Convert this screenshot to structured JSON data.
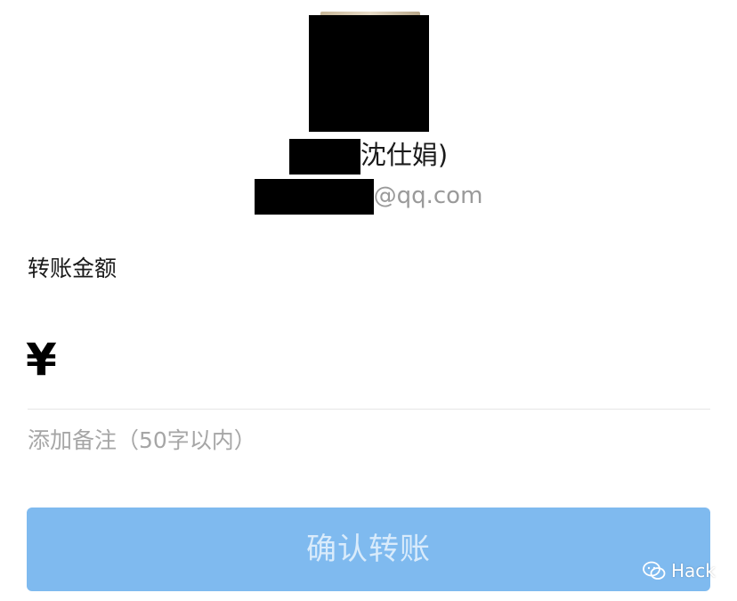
{
  "recipient": {
    "name_suffix": "沈仕娟)",
    "email_suffix": "@qq.com"
  },
  "transfer": {
    "amount_label": "转账金额",
    "currency_symbol": "¥",
    "amount_value": "",
    "note_link": "添加备注（50字以内）",
    "confirm_label": "确认转账"
  },
  "watermark": {
    "text": "Hack"
  },
  "colors": {
    "confirm_button_bg": "#7fbaef",
    "confirm_button_text": "#d9ebfb",
    "muted_text": "#a6a6a6"
  }
}
